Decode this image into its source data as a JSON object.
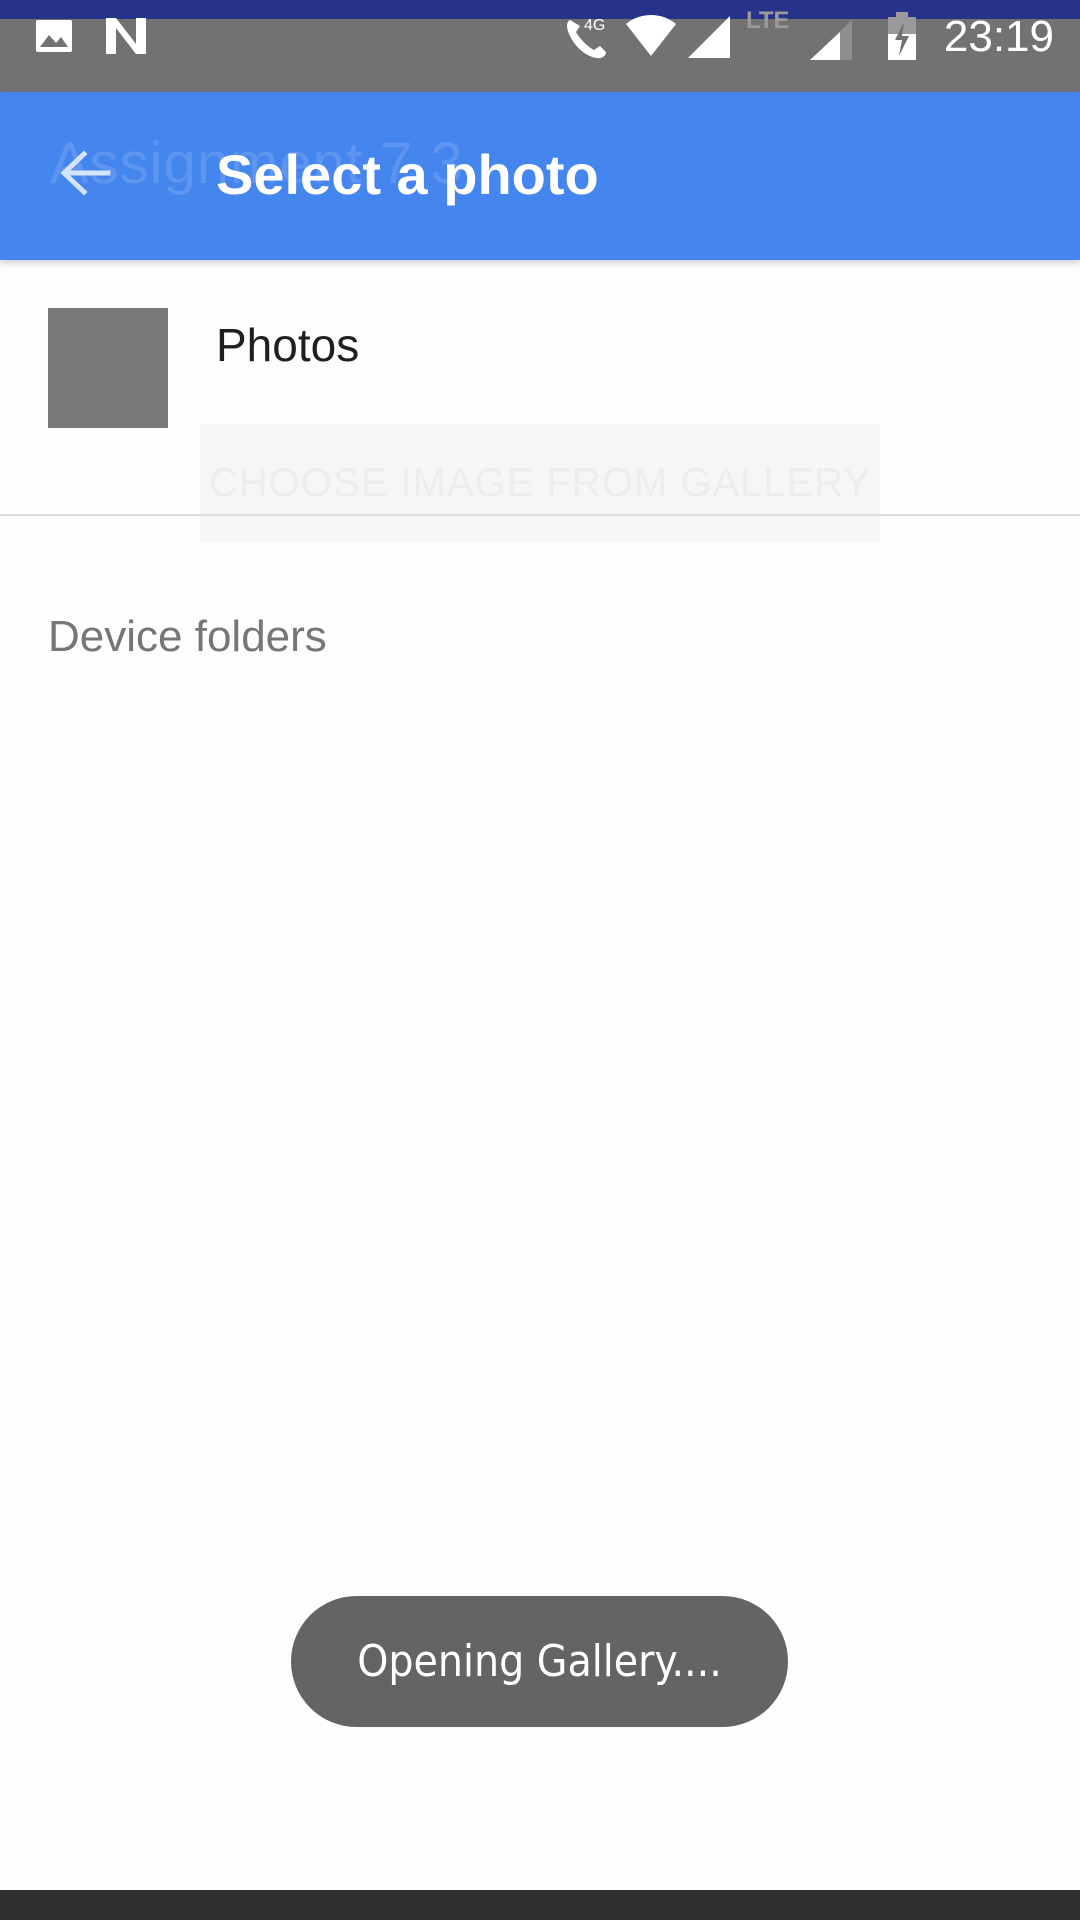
{
  "status_bar": {
    "time": "23:19",
    "network_label": "4G",
    "lte_label": "LTE",
    "icons": [
      "image-icon",
      "n-notification-icon",
      "volte-call-icon",
      "wifi-icon",
      "signal-icon",
      "signal-icon-2",
      "battery-charging-icon"
    ]
  },
  "background_app": {
    "title": "Assignment 7.3",
    "button_label": "CHOOSE IMAGE FROM GALLERY"
  },
  "toolbar": {
    "title": "Select a photo",
    "back_icon": "back-arrow-icon",
    "color": "#4486ee"
  },
  "photos": {
    "label": "Photos"
  },
  "section": {
    "header": "Device folders"
  },
  "toast": {
    "message": "Opening Gallery...."
  }
}
